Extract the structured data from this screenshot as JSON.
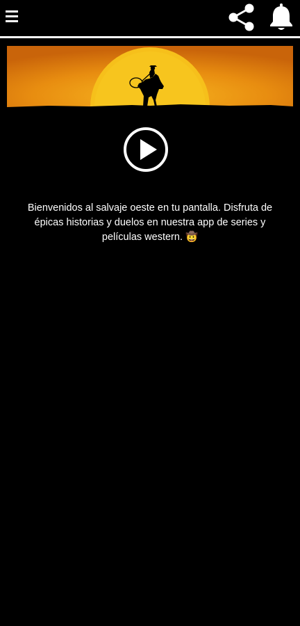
{
  "header": {
    "menu_icon": "hamburger-menu-icon",
    "share_icon": "share-icon",
    "notifications_icon": "bell-icon"
  },
  "banner": {
    "image": "western-sunset-horse-rider-silhouette",
    "colors": {
      "sky": "#e8920e",
      "sun": "#f6c21c",
      "ground": "#000000"
    }
  },
  "player": {
    "play_icon": "play-circle-icon"
  },
  "content": {
    "welcome_text": "Bienvenidos al salvaje oeste en tu pantalla. Disfruta de épicas historias y duelos en nuestra app de series y películas western. 🤠"
  },
  "theme": {
    "background": "#000000",
    "text": "#ffffff"
  }
}
